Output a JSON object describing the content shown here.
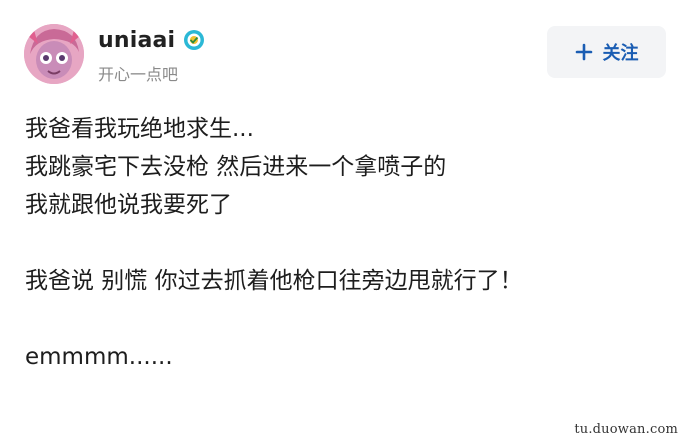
{
  "post": {
    "author": {
      "username": "uniaai",
      "bio": "开心一点吧"
    },
    "follow_button": {
      "label": "关注",
      "icon": "plus-icon"
    },
    "lines": [
      "我爸看我玩绝地求生...",
      "我跳豪宅下去没枪 然后进来一个拿喷子的",
      "我就跟他说我要死了",
      "",
      "我爸说 别慌 你过去抓着他枪口往旁边甩就行了！",
      "",
      "emmmm......"
    ]
  },
  "watermark": "tu.duowan.com",
  "colors": {
    "accent": "#1a5db3",
    "button_bg": "#f3f4f6",
    "muted_text": "#8a8a8a",
    "badge": "#2bb8d6"
  }
}
